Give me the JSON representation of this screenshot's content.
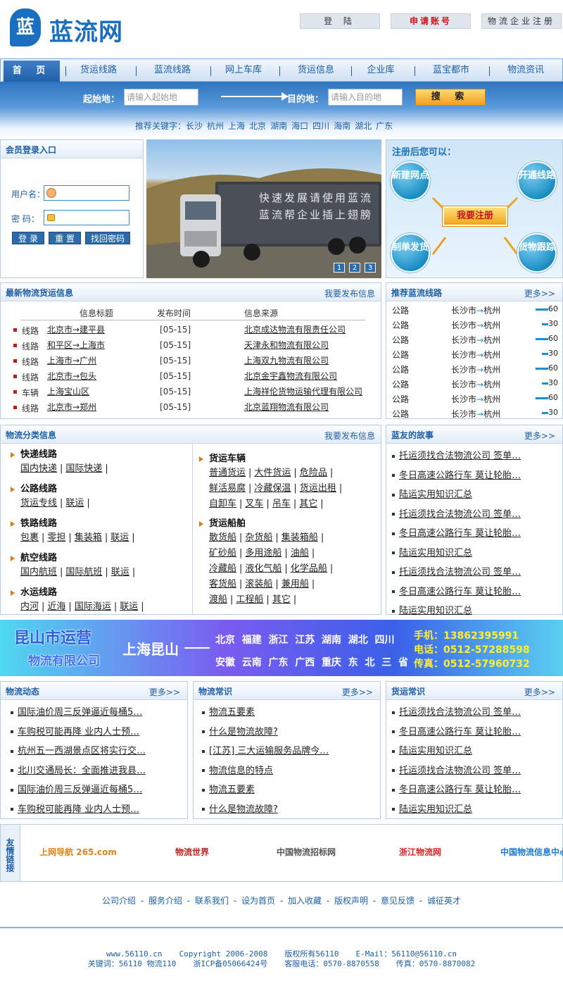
{
  "site": {
    "logo_char": "蓝",
    "logo_text": "蓝流网"
  },
  "top_buttons": {
    "login": "登 陆",
    "apply": "申请账号",
    "register": "物流企业注册"
  },
  "nav": {
    "items": [
      "首 页",
      "货运线路",
      "蓝流线路",
      "网上车库",
      "货运信息",
      "企业库",
      "蓝宝都市",
      "物流资讯"
    ]
  },
  "search": {
    "from_label": "起始地：",
    "from_placeholder": "请输入起始地",
    "to_label": "目的地：",
    "to_placeholder": "请输入目的地",
    "button": "搜 索",
    "keywords_label": "推荐关键字：",
    "keywords": [
      "长沙",
      "杭州",
      "上海",
      "北京",
      "湖南",
      "海口",
      "四川",
      "海南",
      "湖北",
      "广东"
    ]
  },
  "login": {
    "title": "会员登录入口",
    "user_label": "用户名：",
    "pass_label": "密  码：",
    "btn_login": "登 录",
    "btn_reset": "重 置",
    "btn_recover": "找回密码"
  },
  "banner": {
    "truck_text_1": "快速发展请使用蓝流",
    "truck_text_2": "蓝流帮企业插上翅膀",
    "pages": [
      "1",
      "2",
      "3"
    ]
  },
  "register_panel": {
    "title": "注册后您可以：",
    "items": [
      "新建网点",
      "开通线路",
      "制单发货",
      "货物跟踪"
    ],
    "center": "我要注册"
  },
  "latest": {
    "title": "最新物流货运信息",
    "action": "我要发布信息",
    "headers": [
      "信息标题",
      "发布时间",
      "信息来源"
    ],
    "rows": [
      {
        "type": "线路",
        "title": "北京市→建平县",
        "date": "[05-15]",
        "source": "北京成达物流有限责任公司"
      },
      {
        "type": "线路",
        "title": "和平区→上海市",
        "date": "[05-15]",
        "source": "天津永和物流有限公司"
      },
      {
        "type": "线路",
        "title": "上海市→广州",
        "date": "[05-15]",
        "source": "上海双九物流有限公司"
      },
      {
        "type": "线路",
        "title": "北京市→包头",
        "date": "[05-15]",
        "source": "北京金宇鑫物流有限公司"
      },
      {
        "type": "车辆",
        "title": "上海宝山区",
        "date": "[05-15]",
        "source": "上海祥伦货物运输代理有限公司"
      },
      {
        "type": "线路",
        "title": "北京市→郑州",
        "date": "[05-15]",
        "source": "北京蓝翔物流有限公司"
      }
    ]
  },
  "routes": {
    "title": "推荐蓝流线路",
    "more": "更多>>",
    "rows": [
      {
        "type": "公路",
        "from": "长沙市",
        "to": "杭州",
        "value": 60
      },
      {
        "type": "公路",
        "from": "长沙市",
        "to": "杭州",
        "value": 30
      },
      {
        "type": "公路",
        "from": "长沙市",
        "to": "杭州",
        "value": 60
      },
      {
        "type": "公路",
        "from": "长沙市",
        "to": "杭州",
        "value": 30
      },
      {
        "type": "公路",
        "from": "长沙市",
        "to": "杭州",
        "value": 60
      },
      {
        "type": "公路",
        "from": "长沙市",
        "to": "杭州",
        "value": 30
      },
      {
        "type": "公路",
        "from": "长沙市",
        "to": "杭州",
        "value": 60
      },
      {
        "type": "公路",
        "from": "长沙市",
        "to": "杭州",
        "value": 30
      }
    ],
    "arrow": "→"
  },
  "categories": {
    "title": "物流分类信息",
    "action": "我要发布信息",
    "left": [
      {
        "name": "快递线路",
        "links": [
          "国内快递",
          "国际快递"
        ]
      },
      {
        "name": "公路线路",
        "links": [
          "货运专线",
          "联运"
        ]
      },
      {
        "name": "铁路线路",
        "links": [
          "包裹",
          "零担",
          "集装箱",
          "联运"
        ]
      },
      {
        "name": "航空线路",
        "links": [
          "国内航班",
          "国际航班",
          "联运"
        ]
      },
      {
        "name": "水运线路",
        "links": [
          "内河",
          "近海",
          "国际海运",
          "联运"
        ]
      }
    ],
    "right": [
      {
        "name": "货运车辆",
        "lines": [
          [
            "普通货运",
            "大件货运",
            "危险品"
          ],
          [
            "鲜活易腐",
            "冷藏保温",
            "货运出租"
          ],
          [
            "自卸车",
            "叉车",
            "吊车",
            "其它"
          ]
        ]
      },
      {
        "name": "货运船舶",
        "lines": [
          [
            "散货船",
            "杂货船",
            "集装箱船"
          ],
          [
            "矿砂船",
            "多用途船",
            "油船"
          ],
          [
            "冷藏船",
            "液化气船",
            "化学品船"
          ],
          [
            "客货船",
            "滚装船",
            "兼用船"
          ],
          [
            "渡船",
            "工程船",
            "其它"
          ]
        ]
      }
    ]
  },
  "story": {
    "title": "蓝友的故事",
    "more": "更多>>",
    "items": [
      "托运须找合法物流公司 签单…",
      "冬日高速公路行车 莫让轮胎…",
      "陆运实用知识汇总",
      "托运须找合法物流公司 签单…",
      "冬日高速公路行车 莫让轮胎…",
      "陆运实用知识汇总",
      "托运须找合法物流公司 签单…",
      "冬日高速公路行车 莫让轮胎…",
      "陆运实用知识汇总"
    ]
  },
  "ad": {
    "company_1": "昆山市运营",
    "company_2": "物流有限公司",
    "origin": "上海昆山",
    "dest_1": "北京  福建  浙江  江苏  湖南  湖北  四川",
    "dest_2": "安徽  云南  广东  广西  重庆  东  北  三  省",
    "phone": "手机：13862395991",
    "tel": "电话：0512-57288598",
    "fax": "传真：0512-57960732"
  },
  "news": {
    "title": "物流动态",
    "more": "更多>>",
    "items": [
      "国际油价周三反弹逼近每桶5…",
      "车购税可能再降 业内人士预…",
      "杭州五一西湖景点区将实行交…",
      "北川交通局长：全面推进我县…",
      "国际油价周三反弹逼近每桶5…",
      "车购税可能再降 业内人士预…"
    ]
  },
  "knowledge": {
    "title": "物流常识",
    "more": "更多>>",
    "items": [
      "物流五要素",
      "什么是物流故障?",
      "[江苏] 三大运输服务品牌今…",
      "物流信息的特点",
      "物流五要素",
      "什么是物流故障?"
    ]
  },
  "freight": {
    "title": "货运常识",
    "more": "更多>>",
    "items": [
      "托运须找合法物流公司 签单…",
      "冬日高速公路行车 莫让轮胎…",
      "陆运实用知识汇总",
      "托运须找合法物流公司 签单…",
      "冬日高速公路行车 莫让轮胎…",
      "陆运实用知识汇总"
    ]
  },
  "friend_links": {
    "label": "友情链接",
    "logos": [
      "上网导航 265.com",
      "物流世界",
      "中国物流招标网",
      "浙江物流网",
      "中国物流信息中心"
    ]
  },
  "footer": {
    "links": [
      "公司介绍",
      "服务介绍",
      "联系我们",
      "设为首页",
      "加入收藏",
      "版权声明",
      "意见反馈",
      "诚征英才"
    ],
    "line1": [
      "www.56110.cn",
      "Copyright 2006-2008",
      "版权所有56110",
      "E-Mail：56110@56110.cn"
    ],
    "line2": [
      "关键词：56110 物流110",
      "浙ICP备05066424号",
      "客服电话：0570-8870558",
      "传真：0570-8870082"
    ]
  }
}
